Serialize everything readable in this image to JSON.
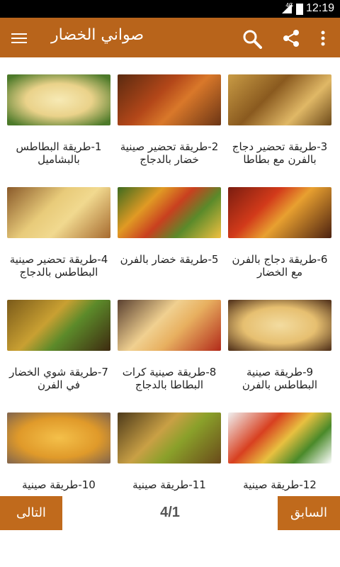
{
  "status": {
    "time": "12:19",
    "network": "4G"
  },
  "appbar": {
    "title": "صواني الخضار"
  },
  "items": [
    {
      "label": "1-طريقة البطاطس بالبشاميل"
    },
    {
      "label": "2-طريقة تحضير صينية خضار بالدجاج"
    },
    {
      "label": "3-طريقة تحضير دجاج بالفرن مع بطاطا"
    },
    {
      "label": "4-طريقة تحضير صينية البطاطس بالدجاج"
    },
    {
      "label": "5-طريقة خضار بالفرن"
    },
    {
      "label": "6-طريقة دجاج بالفرن مع الخضار"
    },
    {
      "label": "7-طريقة شوي الخضار في الفرن"
    },
    {
      "label": "8-طريقة صينية كرات البطاطا بالدجاج"
    },
    {
      "label": "9-طريقة صينية البطاطس بالفرن"
    },
    {
      "label": "10-طريقة صينية"
    },
    {
      "label": "11-طريقة صينية"
    },
    {
      "label": "12-طريقة صينية"
    }
  ],
  "footer": {
    "next_label": "التالى",
    "prev_label": "السابق",
    "page_indicator": "4/1"
  },
  "colors": {
    "primary": "#b8641b",
    "button": "#c06a1c"
  }
}
